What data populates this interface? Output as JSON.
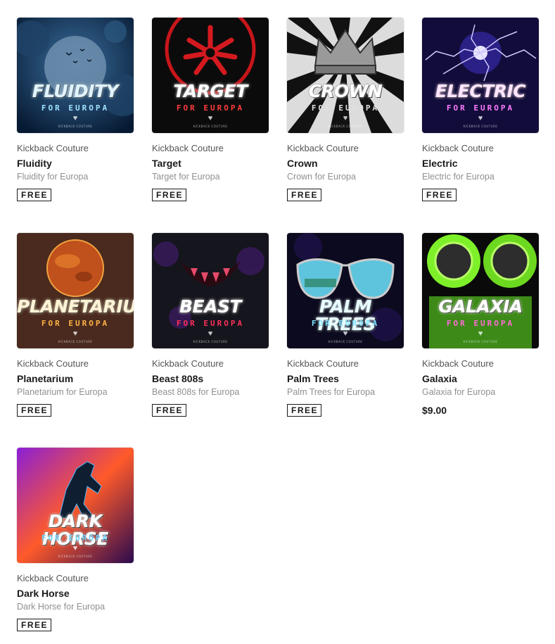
{
  "products": [
    {
      "artist": "Kickback Couture",
      "name": "Fluidity",
      "description": "Fluidity for Europa",
      "price": "FREE",
      "is_free": true,
      "art_title": "Fluidity",
      "art_subtitle": "For Europa",
      "art_brand": "KICKBACK COUTURE",
      "theme": "fluidity",
      "colors": {
        "title": "#dff4ff",
        "subtitle": "#9fe2ff",
        "bg": "#0a2a4f"
      }
    },
    {
      "artist": "Kickback Couture",
      "name": "Target",
      "description": "Target for Europa",
      "price": "FREE",
      "is_free": true,
      "art_title": "Target",
      "art_subtitle": "For Europa",
      "art_brand": "KICKBACK COUTURE",
      "theme": "target",
      "colors": {
        "title": "#ffffff",
        "subtitle": "#ff3b3b",
        "bg": "#0b0b0b"
      }
    },
    {
      "artist": "Kickback Couture",
      "name": "Crown",
      "description": "Crown for Europa",
      "price": "FREE",
      "is_free": true,
      "art_title": "Crown",
      "art_subtitle": "For Europa",
      "art_brand": "KICKBACK COUTURE",
      "theme": "crown",
      "colors": {
        "title": "#ffffff",
        "subtitle": "#e0e0e0",
        "bg": "#1a1a1a"
      }
    },
    {
      "artist": "Kickback Couture",
      "name": "Electric",
      "description": "Electric for Europa",
      "price": "FREE",
      "is_free": true,
      "art_title": "Electric",
      "art_subtitle": "For Europa",
      "art_brand": "KICKBACK COUTURE",
      "theme": "electric",
      "colors": {
        "title": "#ffe6ff",
        "subtitle": "#ff7bff",
        "bg": "#120c3a"
      }
    },
    {
      "artist": "Kickback Couture",
      "name": "Planetarium",
      "description": "Planetarium for Europa",
      "price": "FREE",
      "is_free": true,
      "art_title": "Planetarium",
      "art_subtitle": "For Europa",
      "art_brand": "KICKBACK COUTURE",
      "theme": "planetarium",
      "colors": {
        "title": "#fff3d6",
        "subtitle": "#ffb347",
        "bg": "#4a2a1e"
      }
    },
    {
      "artist": "Kickback Couture",
      "name": "Beast 808s",
      "description": "Beast 808s for Europa",
      "price": "FREE",
      "is_free": true,
      "art_title": "Beast",
      "art_subtitle": "For Europa",
      "art_brand": "KICKBACK COUTURE",
      "theme": "beast",
      "colors": {
        "title": "#ffffff",
        "subtitle": "#ff2f5a",
        "bg": "#1a1a22"
      }
    },
    {
      "artist": "Kickback Couture",
      "name": "Palm Trees",
      "description": "Palm Trees for Europa",
      "price": "FREE",
      "is_free": true,
      "art_title": "Palm Trees",
      "art_subtitle": "For Europa",
      "art_brand": "KICKBACK COUTURE",
      "theme": "palm",
      "colors": {
        "title": "#e8fbff",
        "subtitle": "#7fe3ff",
        "bg": "#0c0a1e"
      }
    },
    {
      "artist": "Kickback Couture",
      "name": "Galaxia",
      "description": "Galaxia for Europa",
      "price": "$9.00",
      "is_free": false,
      "art_title": "Galaxia",
      "art_subtitle": "For Europa",
      "art_brand": "KICKBACK COUTURE",
      "theme": "galaxia",
      "colors": {
        "title": "#ffffff",
        "subtitle": "#ff6bd6",
        "bg": "#0a0a0a"
      }
    },
    {
      "artist": "Kickback Couture",
      "name": "Dark Horse",
      "description": "Dark Horse for Europa",
      "price": "FREE",
      "is_free": true,
      "art_title": "Dark Horse",
      "art_subtitle": "For Europa",
      "art_brand": "KICKBACK COUTURE",
      "theme": "darkhorse",
      "colors": {
        "title": "#ffffff",
        "subtitle": "#6ad1ff",
        "bg": "#2a1020"
      }
    }
  ]
}
